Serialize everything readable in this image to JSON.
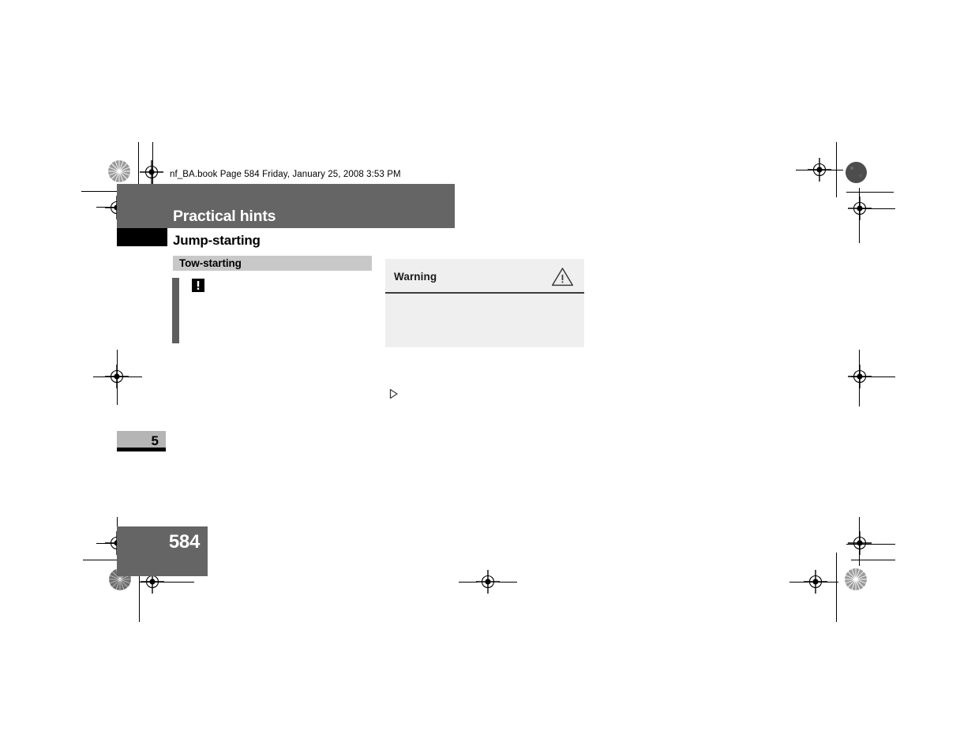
{
  "document": {
    "header_line": "nf_BA.book  Page 584  Friday, January 25, 2008  3:53 PM",
    "chapter_title": "Practical hints",
    "section_title": "Jump-starting",
    "subsection_title": "Tow-starting",
    "chapter_number": "5",
    "page_number": "584"
  },
  "warning_box": {
    "label": "Warning",
    "icon_name": "warning-triangle-icon",
    "body_text": ""
  },
  "note": {
    "icon_name": "exclamation-note-icon"
  },
  "continuation": {
    "icon_name": "triangle-right-continuation-icon"
  },
  "colors": {
    "band_gray": "#656565",
    "subhead_gray": "#c8c8c8",
    "warning_bg": "#efefef",
    "tab_gray": "#b5b5b5",
    "black": "#000000",
    "white": "#ffffff",
    "change_bar": "#5e5e5e",
    "warning_rule": "#3c3c3c"
  },
  "print_marks": {
    "registration_target_name": "registration-target-mark",
    "density_patch_name": "density-patch-mark",
    "star_patch_name": "star-target-mark",
    "crop_rule_name": "crop-rule"
  }
}
